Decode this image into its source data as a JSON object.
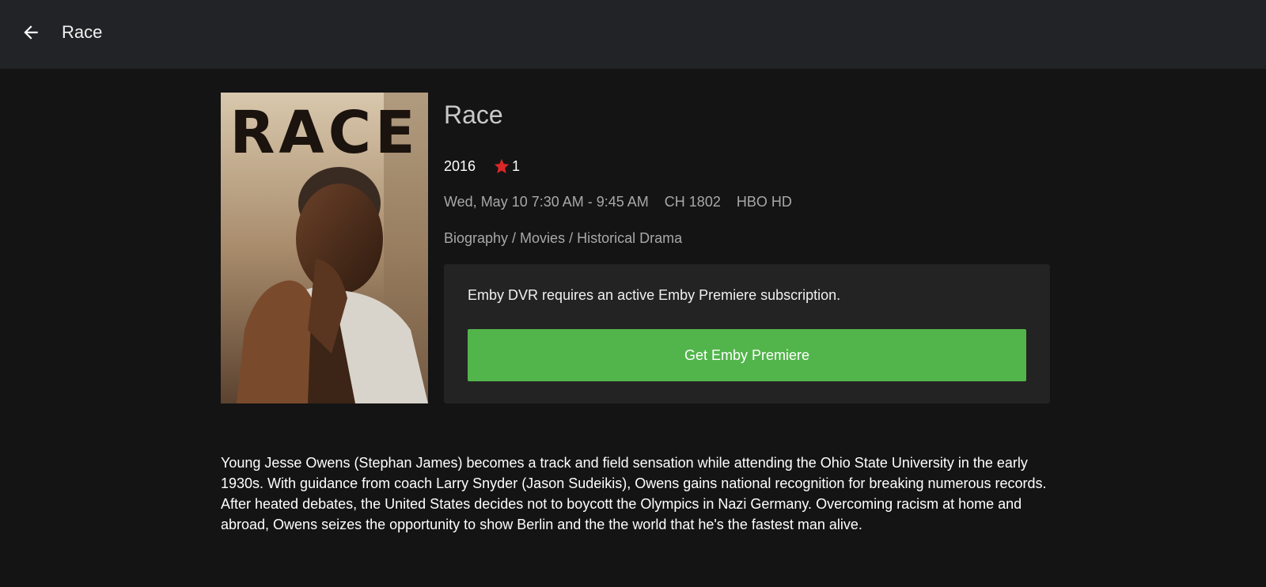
{
  "header": {
    "title": "Race",
    "back_icon": "arrow-left-icon"
  },
  "poster": {
    "title_text": "RACE"
  },
  "item": {
    "title": "Race",
    "year": "2016",
    "rating_icon": "star-icon",
    "rating_value": "1",
    "airtime": "Wed, May 10 7:30 AM - 9:45 AM",
    "channel_number": "CH 1802",
    "channel_name": "HBO HD",
    "genres": "Biography / Movies / Historical Drama"
  },
  "premiere": {
    "message": "Emby DVR requires an active Emby Premiere subscription.",
    "button_label": "Get Emby Premiere"
  },
  "overview": "Young Jesse Owens (Stephan James) becomes a track and field sensation while attending the Ohio State University in the early 1930s. With guidance from coach Larry Snyder (Jason Sudeikis), Owens gains national recognition for breaking numerous records. After heated debates, the United States decides not to boycott the Olympics in Nazi Germany. Overcoming racism at home and abroad, Owens seizes the opportunity to show Berlin and the the world that he's the fastest man alive.",
  "colors": {
    "accent_green": "#52b54b",
    "star_red": "#d92727",
    "header_bg": "#222326",
    "page_bg": "#141414"
  }
}
